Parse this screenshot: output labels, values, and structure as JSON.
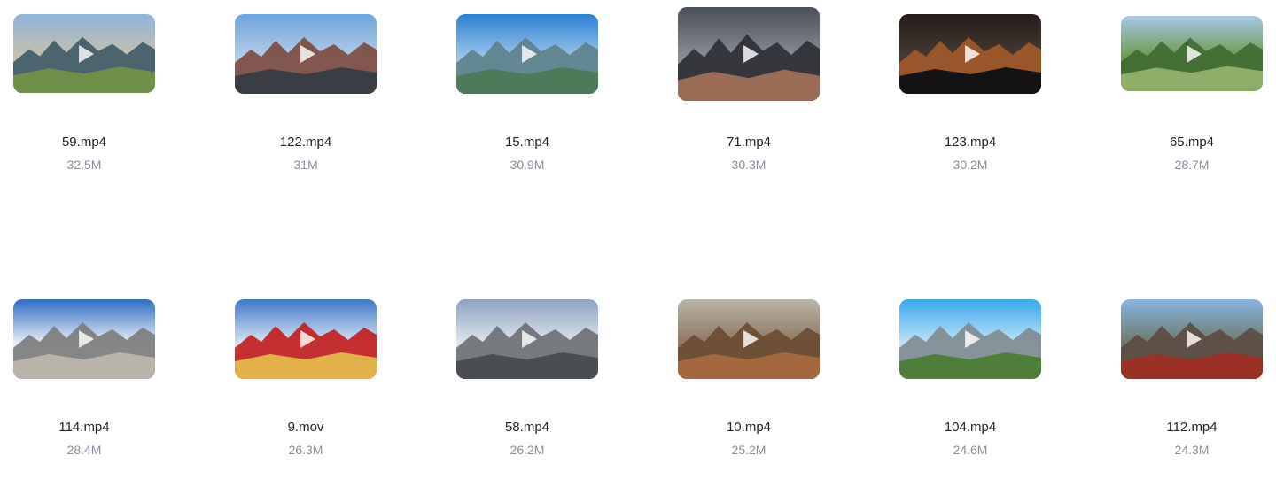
{
  "videos": [
    {
      "name": "59.mp4",
      "size": "32.5M",
      "scene": "city-street-sunset-icon",
      "colors": [
        "#8fb3d9",
        "#c8c1ad",
        "#3e5a66",
        "#6f8f4a"
      ]
    },
    {
      "name": "122.mp4",
      "size": "31M",
      "scene": "city-towers-icon",
      "colors": [
        "#6ea4dd",
        "#b6cde8",
        "#7b4a3e",
        "#3a3d44"
      ]
    },
    {
      "name": "15.mp4",
      "size": "30.9M",
      "scene": "riverside-city-icon",
      "colors": [
        "#2d7fd3",
        "#9cc6ea",
        "#5d7f8a",
        "#4f7a5a"
      ]
    },
    {
      "name": "71.mp4",
      "size": "30.3M",
      "scene": "mall-interior-night-icon",
      "colors": [
        "#4a4e57",
        "#8a8f9a",
        "#2b2d33",
        "#9a6b55"
      ]
    },
    {
      "name": "123.mp4",
      "size": "30.2M",
      "scene": "city-night-traffic-icon",
      "colors": [
        "#221c1a",
        "#4a3a33",
        "#a25a2a",
        "#141214"
      ]
    },
    {
      "name": "65.mp4",
      "size": "28.7M",
      "scene": "great-wall-green-icon",
      "colors": [
        "#a7c7e6",
        "#6d9a4f",
        "#3f6b32",
        "#8fae6a"
      ]
    },
    {
      "name": "114.mp4",
      "size": "28.4M",
      "scene": "forbidden-city-icon",
      "colors": [
        "#2f6cc4",
        "#e8eef6",
        "#7a7a7a",
        "#b8b3ab"
      ]
    },
    {
      "name": "9.mov",
      "size": "26.3M",
      "scene": "red-palace-walls-icon",
      "colors": [
        "#3f78c9",
        "#d8e4f2",
        "#c21c1c",
        "#e3b14a"
      ]
    },
    {
      "name": "58.mp4",
      "size": "26.2M",
      "scene": "birds-nest-stadium-icon",
      "colors": [
        "#8da2c2",
        "#dfe4ec",
        "#6b6e73",
        "#4a4d52"
      ]
    },
    {
      "name": "10.mp4",
      "size": "25.2M",
      "scene": "great-wall-autumn-icon",
      "colors": [
        "#b9b5a8",
        "#8e7760",
        "#6a4b32",
        "#a3683d"
      ]
    },
    {
      "name": "104.mp4",
      "size": "24.6M",
      "scene": "old-ruins-icon",
      "colors": [
        "#3aa6ee",
        "#bfe3f7",
        "#7f8a8f",
        "#4f7d3a"
      ]
    },
    {
      "name": "112.mp4",
      "size": "24.3M",
      "scene": "hutong-street-icon",
      "colors": [
        "#87b4e0",
        "#6e7a6a",
        "#5c4a44",
        "#9a3026"
      ]
    }
  ]
}
